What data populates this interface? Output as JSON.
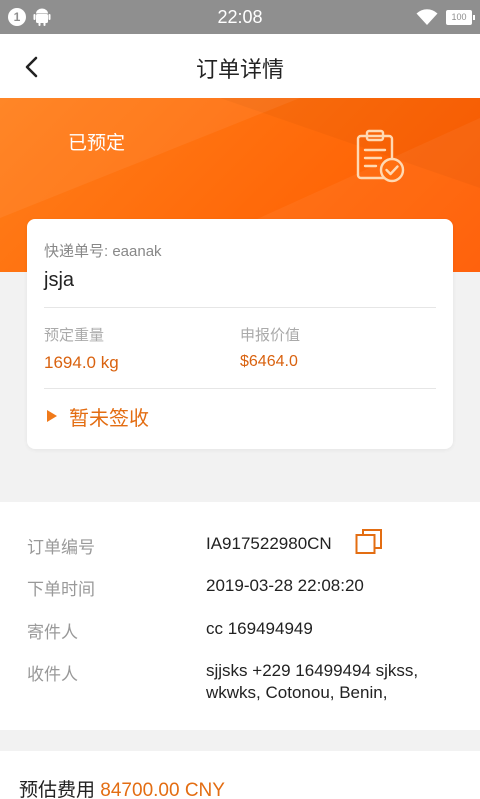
{
  "status_bar": {
    "notification_count": "1",
    "time": "22:08",
    "battery": "100",
    "icons": [
      "android-icon",
      "wifi-icon",
      "battery-icon"
    ]
  },
  "nav": {
    "title": "订单详情",
    "back_icon": "chevron-left-icon"
  },
  "hero": {
    "status": "已预定",
    "icon": "clipboard-check-icon",
    "gradient_colors": [
      "#ff7f1a",
      "#ff5a00"
    ]
  },
  "card": {
    "tracking_label": "快递单号:",
    "tracking_value": "eaanak",
    "name": "jsja",
    "weight_label": "预定重量",
    "weight_value": "1694.0 kg",
    "declared_label": "申报价值",
    "declared_value": "$6464.0",
    "sign_status": "暂未签收"
  },
  "details": {
    "order_no_label": "订单编号",
    "order_no": "IA917522980CN",
    "order_time_label": "下单时间",
    "order_time": "2019-03-28 22:08:20",
    "sender_label": "寄件人",
    "sender": "cc 169494949",
    "receiver_label": "收件人",
    "receiver_line1": "sjjsks +229 16499494 sjkss,",
    "receiver_line2": "wkwks, Cotonou, Benin,"
  },
  "fee": {
    "label": "预估费用",
    "amount": "84700.00 CNY"
  },
  "colors": {
    "accent": "#e36d12",
    "status_bar": "#8f8f8f"
  }
}
